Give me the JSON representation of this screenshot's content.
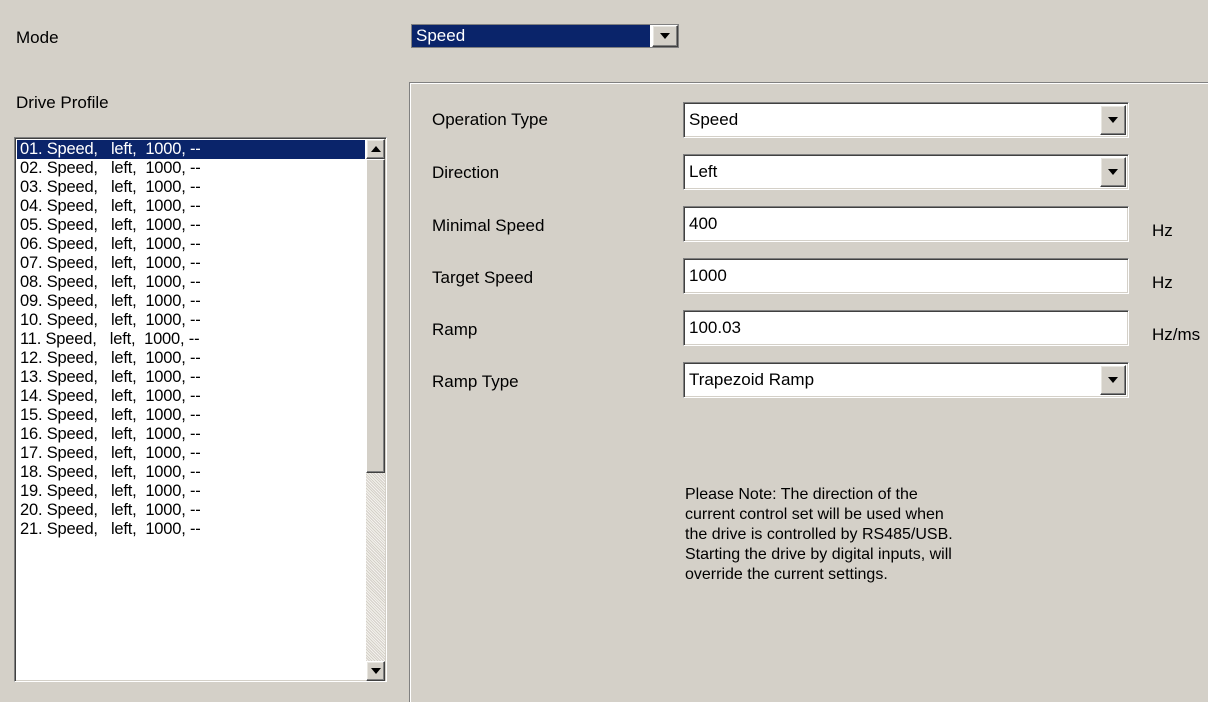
{
  "mode": {
    "label": "Mode",
    "value": "Speed"
  },
  "profile": {
    "label": "Drive Profile",
    "items": [
      "01. Speed,   left,  1000, --",
      "02. Speed,   left,  1000, --",
      "03. Speed,   left,  1000, --",
      "04. Speed,   left,  1000, --",
      "05. Speed,   left,  1000, --",
      "06. Speed,   left,  1000, --",
      "07. Speed,   left,  1000, --",
      "08. Speed,   left,  1000, --",
      "09. Speed,   left,  1000, --",
      "10. Speed,   left,  1000, --",
      "11. Speed,   left,  1000, --",
      "12. Speed,   left,  1000, --",
      "13. Speed,   left,  1000, --",
      "14. Speed,   left,  1000, --",
      "15. Speed,   left,  1000, --",
      "16. Speed,   left,  1000, --",
      "17. Speed,   left,  1000, --",
      "18. Speed,   left,  1000, --",
      "19. Speed,   left,  1000, --",
      "20. Speed,   left,  1000, --",
      "21. Speed,   left,  1000, --"
    ],
    "selected_index": 0
  },
  "settings": {
    "operation_type": {
      "label": "Operation Type",
      "value": "Speed"
    },
    "direction": {
      "label": "Direction",
      "value": "Left"
    },
    "minimal_speed": {
      "label": "Minimal Speed",
      "value": "400",
      "unit": "Hz"
    },
    "target_speed": {
      "label": "Target Speed",
      "value": "1000",
      "unit": "Hz"
    },
    "ramp": {
      "label": "Ramp",
      "value": "100.03",
      "unit": "Hz/ms"
    },
    "ramp_type": {
      "label": "Ramp Type",
      "value": "Trapezoid Ramp"
    }
  },
  "note": {
    "lines": [
      "Please Note: The direction of the",
      "current control set will be used when",
      "the drive is controlled by RS485/USB.",
      "Starting the drive by digital inputs, will",
      "override the current settings."
    ]
  },
  "colors": {
    "window_bg": "#d4d0c8",
    "selection_bg": "#0a246a",
    "selection_fg": "#ffffff"
  }
}
